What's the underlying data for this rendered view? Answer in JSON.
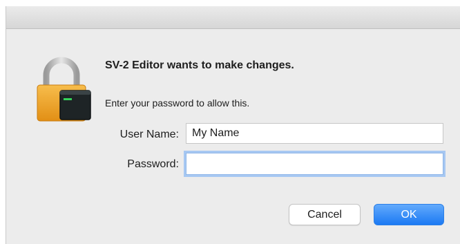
{
  "dialog": {
    "app_name": "SV-2 Editor",
    "headline_rest": " wants to make changes.",
    "prompt": "Enter your password to allow this."
  },
  "form": {
    "username_label": "User Name:",
    "username_value": "My Name",
    "password_label": "Password:",
    "password_value": ""
  },
  "buttons": {
    "cancel_label": "Cancel",
    "ok_label": "OK"
  },
  "icons": {
    "lock": "padlock-terminal-icon"
  },
  "colors": {
    "accent": "#1b79f3",
    "focus_ring": "#a7c8f2",
    "lock_body": "#f2a42a"
  }
}
